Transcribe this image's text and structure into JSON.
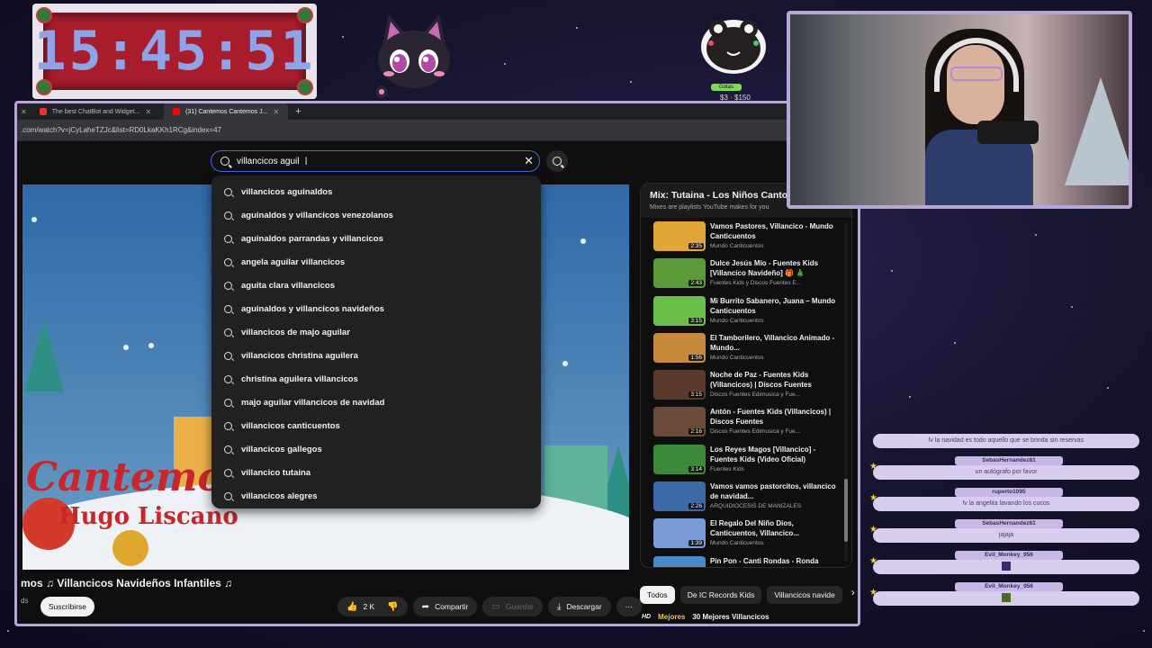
{
  "clock": {
    "time": "15:45:51"
  },
  "goal": {
    "badge": "Gotas",
    "range": "$3 · $150"
  },
  "browser": {
    "tabs": [
      {
        "label": "The best ChatBot and Widget...",
        "favicon_color": "#e33"
      },
      {
        "label": "(31) Cantemos Cantemos J...",
        "favicon_color": "#f00"
      }
    ],
    "new_tab": "+",
    "url": ".com/watch?v=jCyLaheTZJc&list=RD0LkaKKh1RCg&index=47"
  },
  "search": {
    "query": "villancicos aguil",
    "clear": "✕",
    "suggestions": [
      "villancicos aguinaldos",
      "aguinaldos y villancicos venezolanos",
      "aguinaldos parrandas y villancicos",
      "angela aguilar villancicos",
      "aguita clara villancicos",
      "aguinaldos y villancicos navideños",
      "villancicos de majo aguilar",
      "villancicos christina aguilera",
      "christina aguilera villancicos",
      "majo aguilar villancicos de navidad",
      "villancicos canticuentos",
      "villancicos gallegos",
      "villancico tutaina",
      "villancicos alegres"
    ]
  },
  "video": {
    "overlay_title": "Cantemo",
    "overlay_subtitle": "Hugo Liscano",
    "heading": "mos ♫ Villancicos Navideños Infantiles ♫",
    "channel_fragment": "ds",
    "subscribe": "Suscribirse",
    "likes": "2 K",
    "share": "Compartir",
    "save": "Guardar",
    "download": "Descargar",
    "more": "⋯"
  },
  "playlist": {
    "title": "Mix: Tutaina - Los Niños Canto",
    "subtitle": "Mixes are playlists YouTube makes for you",
    "items": [
      {
        "title": "Vamos Pastores, Villancico - Mundo Canticuentos",
        "channel": "Mundo Canticuentos",
        "duration": "2:35",
        "color": "#e0a63a"
      },
      {
        "title": "Dulce Jesús Mío - Fuentes Kids [Villancico Navideño] 🎁 🎄",
        "channel": "Fuentes Kids y Discos Fuentes E...",
        "duration": "2:43",
        "color": "#5a9a3b"
      },
      {
        "title": "Mi Burrito Sabanero, Juana – Mundo Canticuentos",
        "channel": "Mundo Canticuentos",
        "duration": "3:15",
        "color": "#6cbf4a"
      },
      {
        "title": "El Tamborilero, Villancico Animado - Mundo...",
        "channel": "Mundo Canticuentos",
        "duration": "1:56",
        "color": "#c58a3c"
      },
      {
        "title": "Noche de Paz - Fuentes Kids (Villancicos) | Discos Fuentes",
        "channel": "Discos Fuentes Edimusica y Fue...",
        "duration": "3:15",
        "color": "#5a3a2a"
      },
      {
        "title": "Antón - Fuentes Kids (Villancicos) | Discos Fuentes",
        "channel": "Discos Fuentes Edimusica y Fue...",
        "duration": "2:16",
        "color": "#6b4a3a"
      },
      {
        "title": "Los Reyes Magos [Villancico] - Fuentes Kids (Video Oficial)",
        "channel": "Fuentes Kids",
        "duration": "3:14",
        "color": "#3a8a3a"
      },
      {
        "title": "Vamos vamos pastorcitos, villancico de navidad...",
        "channel": "ARQUIDIOCESIS DE MANIZALES",
        "duration": "2:26",
        "color": "#3a6aa8"
      },
      {
        "title": "El Regalo Del Niño Dios, Canticuentos, Villancico...",
        "channel": "Mundo Canticuentos",
        "duration": "1:39",
        "color": "#7a9ad8"
      },
      {
        "title": "Pin Pon - Canti Rondas - Ronda",
        "channel": "",
        "duration": "",
        "color": "#4a8ac8"
      }
    ]
  },
  "chips": [
    "Todos",
    "De IC Records Kids",
    "Villancicos navide"
  ],
  "next_row": {
    "hd": "HD",
    "label": "Mejores",
    "title": "30 Mejores Villancicos"
  },
  "chat": [
    {
      "name": "",
      "text": "lv la navidad es todo aquello que se brinda sin reservas"
    },
    {
      "name": "SebasHernandez61",
      "text": "un autógrafo por favor"
    },
    {
      "name": "ruperto1095",
      "text": "lv la angelita lavando los cucos"
    },
    {
      "name": "SebasHernandez61",
      "text": "jajaja"
    },
    {
      "name": "Evil_Monkey_956",
      "text": ""
    },
    {
      "name": "Evil_Monkey_956",
      "text": ""
    }
  ]
}
